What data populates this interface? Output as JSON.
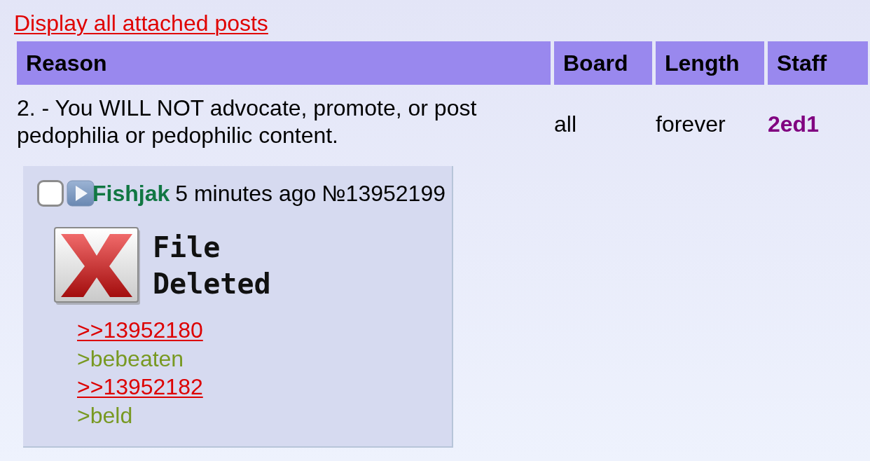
{
  "link": {
    "text": "Display all attached posts"
  },
  "table": {
    "columns": [
      "Reason",
      "Board",
      "Length",
      "Staff"
    ],
    "rows": [
      {
        "reason": "2. - You WILL NOT advocate, promote, or post pedophilia or pedophilic content.",
        "board": "all",
        "length": "forever",
        "staff": "2ed1"
      }
    ]
  },
  "post": {
    "checked": false,
    "name": "Fishjak",
    "time": "5 minutes ago",
    "number": "№13952199",
    "file": {
      "text": "File Deleted"
    },
    "lines": [
      {
        "kind": "quotelink",
        "text": ">>13952180"
      },
      {
        "kind": "greentext",
        "text": ">bebeaten"
      },
      {
        "kind": "quotelink",
        "text": ">>13952182"
      },
      {
        "kind": "greentext",
        "text": ">beld"
      }
    ]
  }
}
